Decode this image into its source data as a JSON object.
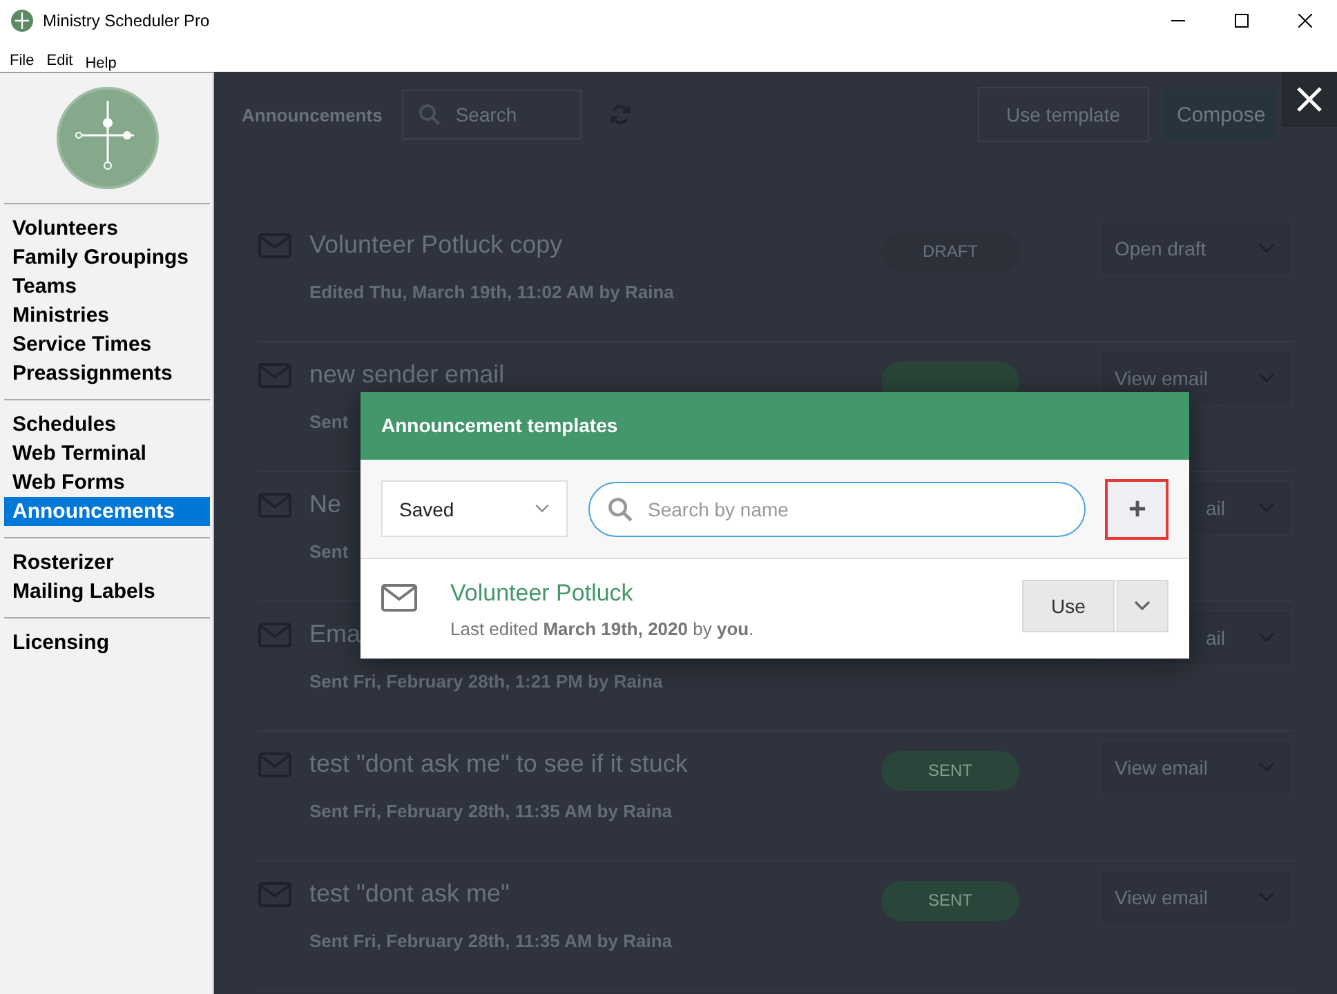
{
  "window": {
    "title": "Ministry Scheduler Pro"
  },
  "menu": [
    "File",
    "Edit",
    "Help"
  ],
  "sidebar": {
    "groups": [
      {
        "items": [
          {
            "label": "Volunteers",
            "selected": false
          },
          {
            "label": "Family Groupings",
            "selected": false
          },
          {
            "label": "Teams",
            "selected": false
          },
          {
            "label": "Ministries",
            "selected": false
          },
          {
            "label": "Service Times",
            "selected": false
          },
          {
            "label": "Preassignments",
            "selected": false
          }
        ]
      },
      {
        "items": [
          {
            "label": "Schedules",
            "selected": false
          },
          {
            "label": "Web Terminal",
            "selected": false
          },
          {
            "label": "Web Forms",
            "selected": false
          },
          {
            "label": "Announcements",
            "selected": true
          }
        ]
      },
      {
        "items": [
          {
            "label": "Rosterizer",
            "selected": false
          },
          {
            "label": "Mailing Labels",
            "selected": false
          }
        ]
      },
      {
        "items": [
          {
            "label": "Licensing",
            "selected": false
          }
        ]
      }
    ]
  },
  "page": {
    "title": "Announcements",
    "search": {
      "placeholder": "Search"
    },
    "use_template": "Use template",
    "compose": "Compose",
    "rows": [
      {
        "title": "Volunteer Potluck copy",
        "subtitle": "Edited Thu, March 19th, 11:02 AM by Raina",
        "status": "DRAFT",
        "kind": "draft",
        "action": "Open draft"
      },
      {
        "title": "new sender email",
        "subtitle": "Sent",
        "status": "",
        "kind": "sent",
        "action": "View email"
      },
      {
        "title": "Ne",
        "subtitle": "Sent",
        "status": "",
        "kind": "hidden",
        "action": "ail"
      },
      {
        "title": "Ema",
        "subtitle": "Sent Fri, February 28th, 1:21 PM by Raina",
        "status": "",
        "kind": "hidden",
        "action": "ail"
      },
      {
        "title": "test \"dont ask me\" to see if it stuck",
        "subtitle": "Sent Fri, February 28th, 11:35 AM by Raina",
        "status": "SENT",
        "kind": "sent",
        "action": "View email"
      },
      {
        "title": "test \"dont ask me\"",
        "subtitle": "Sent Fri, February 28th, 11:35 AM by Raina",
        "status": "SENT",
        "kind": "sent",
        "action": "View email"
      }
    ]
  },
  "modal": {
    "title": "Announcement templates",
    "filter": "Saved",
    "search": {
      "placeholder": "Search by name"
    },
    "templates": [
      {
        "name": "Volunteer Potluck",
        "meta": "Last edited **March 19th, 2020** by **you**.",
        "use": "Use"
      }
    ]
  }
}
